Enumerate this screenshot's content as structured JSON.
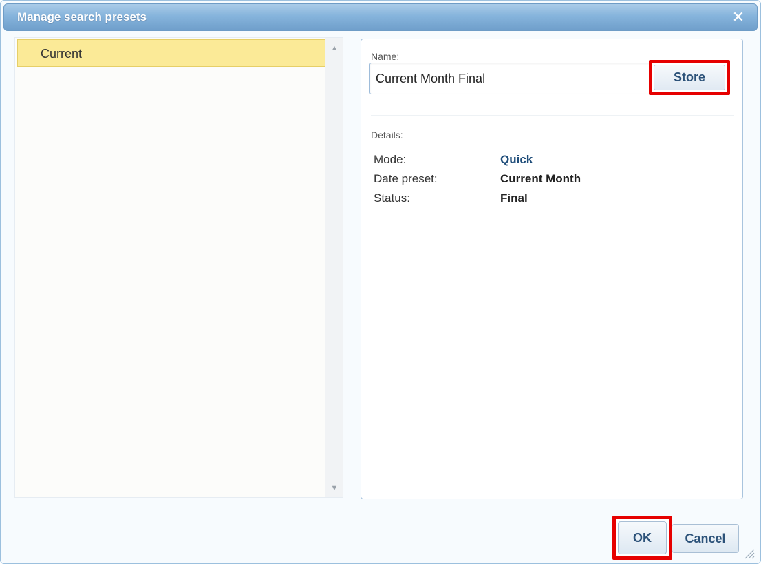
{
  "dialog": {
    "title": "Manage search presets",
    "close_icon": "close-icon"
  },
  "presets_list": {
    "items": [
      {
        "label": "Current",
        "selected": true
      }
    ]
  },
  "form": {
    "name_label": "Name:",
    "name_value": "Current Month Final",
    "store_label": "Store",
    "details_label": "Details:",
    "details": [
      {
        "key": "Mode:",
        "value": "Quick"
      },
      {
        "key": "Date preset:",
        "value": "Current Month"
      },
      {
        "key": "Status:",
        "value": "Final"
      }
    ]
  },
  "footer": {
    "ok_label": "OK",
    "cancel_label": "Cancel"
  },
  "colors": {
    "titlebar": "#86b4dc",
    "selected_item": "#fbea97",
    "highlight": "#e60000",
    "button_text": "#2c5279"
  }
}
